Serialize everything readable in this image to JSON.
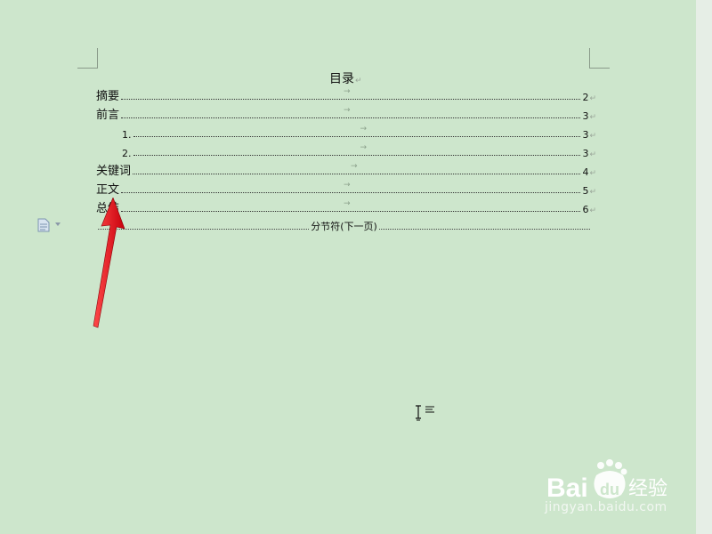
{
  "document": {
    "toc_title": "目录",
    "toc_entries": [
      {
        "label": "摘要",
        "page": "2",
        "level": 1
      },
      {
        "label": "前言",
        "page": "3",
        "level": 1
      },
      {
        "label": "1.",
        "page": "3",
        "level": 2
      },
      {
        "label": "2.",
        "page": "3",
        "level": 2
      },
      {
        "label": "关键词",
        "page": "4",
        "level": 1
      },
      {
        "label": "正文",
        "page": "5",
        "level": 1
      },
      {
        "label": "总结",
        "page": "6",
        "level": 1
      }
    ],
    "section_break_label": "分节符(下一页)"
  },
  "marks": {
    "paragraph": "↵",
    "tab": "→"
  },
  "watermark": {
    "logo_text": "Bai",
    "logo_paw_text": "du",
    "logo_cn": "经验",
    "url": "jingyan.baidu.com"
  },
  "icons": [
    "document-icon",
    "dropdown-caret-icon",
    "text-cursor-icon",
    "align-left-icon",
    "annotation-arrow"
  ],
  "colors": {
    "background": "#cde6cc",
    "arrow": "#e3101a",
    "watermark": "#ffffff"
  }
}
